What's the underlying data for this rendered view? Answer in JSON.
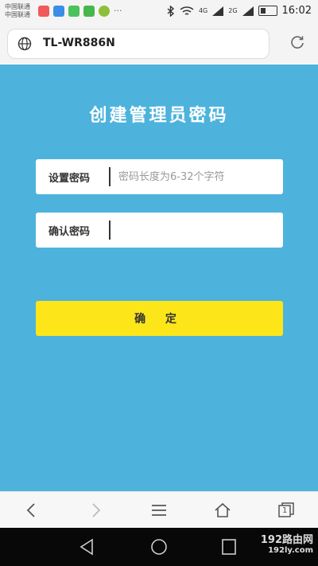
{
  "status_bar": {
    "carrier_1": "中国联通",
    "carrier_2": "中国联通",
    "network_1": "4G",
    "network_2": "2G",
    "time": "16:02",
    "more": "···",
    "notification_colors": [
      "#f05a5a",
      "#3a8ee6",
      "#4cc25c",
      "#46b84b",
      "#888888"
    ]
  },
  "address_bar": {
    "url": "TL-WR886N",
    "globe_icon": "globe-icon",
    "reload_icon": "reload-icon"
  },
  "form": {
    "title": "创建管理员密码",
    "password_label": "设置密码",
    "password_placeholder": "密码长度为6-32个字符",
    "password_value": "",
    "confirm_label": "确认密码",
    "confirm_value": "",
    "submit_label": "确 定"
  },
  "colors": {
    "background": "#4db3dc",
    "button": "#fce518"
  },
  "browser_bar": {
    "icons": [
      "back-icon",
      "forward-icon",
      "menu-icon",
      "home-icon",
      "tabs-icon"
    ],
    "tab_count": "1"
  },
  "watermark": {
    "brand": "192路由网",
    "site": "192ly.com"
  }
}
